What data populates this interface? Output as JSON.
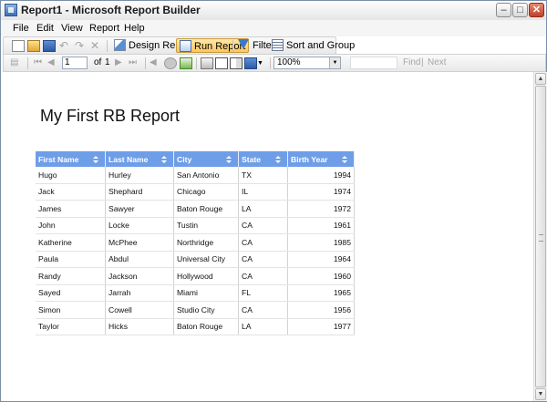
{
  "window": {
    "title": "Report1 - Microsoft Report Builder"
  },
  "menu": {
    "items": [
      {
        "label": "File"
      },
      {
        "label": "Edit"
      },
      {
        "label": "View"
      },
      {
        "label": "Report"
      },
      {
        "label": "Help"
      }
    ]
  },
  "toolbar": {
    "design_report": "Design Report",
    "run_report": "Run Report",
    "filter": "Filter",
    "sort_and_group": "Sort and Group"
  },
  "nav": {
    "page_value": "1",
    "of_label": "of",
    "total_pages": "1",
    "zoom": "100%",
    "find_label": "Find",
    "separator": "|",
    "next_label": "Next"
  },
  "report": {
    "title": "My First RB Report",
    "columns": [
      "First Name",
      "Last Name",
      "City",
      "State",
      "Birth Year"
    ],
    "rows": [
      [
        "Hugo",
        "Hurley",
        "San Antonio",
        "TX",
        "1994"
      ],
      [
        "Jack",
        "Shephard",
        "Chicago",
        "IL",
        "1974"
      ],
      [
        "James",
        "Sawyer",
        "Baton Rouge",
        "LA",
        "1972"
      ],
      [
        "John",
        "Locke",
        "Tustin",
        "CA",
        "1961"
      ],
      [
        "Katherine",
        "McPhee",
        "Northridge",
        "CA",
        "1985"
      ],
      [
        "Paula",
        "Abdul",
        "Universal City",
        "CA",
        "1964"
      ],
      [
        "Randy",
        "Jackson",
        "Hollywood",
        "CA",
        "1960"
      ],
      [
        "Sayed",
        "Jarrah",
        "Miami",
        "FL",
        "1965"
      ],
      [
        "Simon",
        "Cowell",
        "Studio City",
        "CA",
        "1956"
      ],
      [
        "Taylor",
        "Hicks",
        "Baton Rouge",
        "LA",
        "1977"
      ]
    ]
  },
  "colors": {
    "header_bg": "#6f9ee8",
    "active_button": "#ffc65c"
  }
}
